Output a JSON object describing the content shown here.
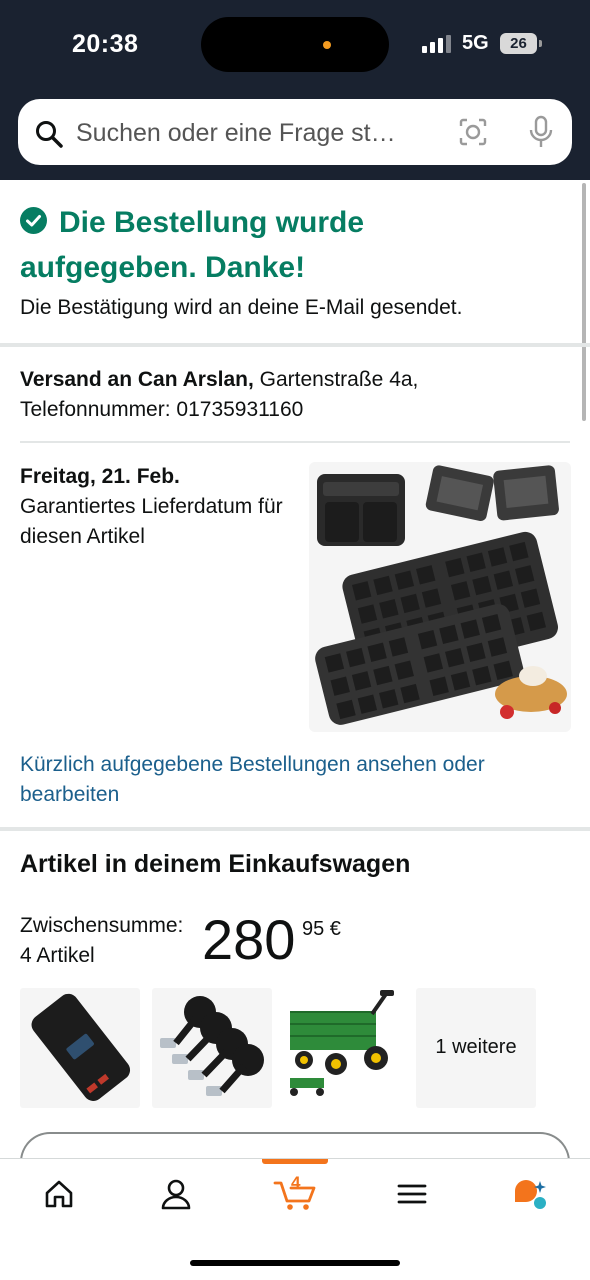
{
  "status_bar": {
    "time": "20:38",
    "network": "5G",
    "battery": "26"
  },
  "search": {
    "placeholder": "Suchen oder eine Frage st…"
  },
  "confirmation": {
    "heading": "Die Bestellung wurde aufgegeben. Danke!",
    "subtext": "Die Bestätigung wird an deine E-Mail gesendet."
  },
  "shipping": {
    "label": "Versand an Can Arslan,",
    "address": " Gartenstraße 4a, Telefonnummer: 01735931160"
  },
  "delivery": {
    "date": "Freitag, 21. Feb.",
    "note": "Garantiertes Lieferdatum für diesen Artikel"
  },
  "orders_link": "Kürzlich aufgegebene Bestellungen ansehen oder bearbeiten",
  "cart": {
    "title": "Artikel in deinem Einkaufswagen",
    "subtotal_label": "Zwischensumme:",
    "item_count": "4 Artikel",
    "price_whole": "280",
    "price_fraction": "95 €",
    "more_label": "1 weitere"
  },
  "bottom_nav": {
    "cart_count": "4"
  },
  "colors": {
    "header_bg": "#1a2230",
    "success_green": "#067d62",
    "link_blue": "#1b5f8c",
    "accent_orange": "#f3741c"
  }
}
